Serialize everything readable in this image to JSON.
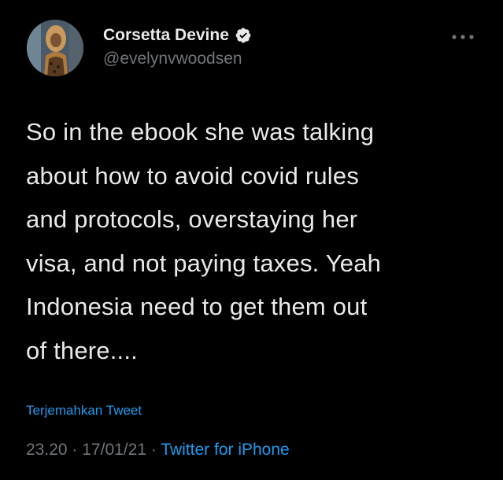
{
  "user": {
    "display_name": "Corsetta Devine",
    "handle": "@evelynvwoodsen",
    "verified": true
  },
  "tweet": {
    "text": "So in the ebook she was talking\nabout how to avoid covid rules\nand protocols, overstaying her\nvisa, and not paying taxes. Yeah\nIndonesia need to get them out\nof there....",
    "translate_label": "Terjemahkan Tweet",
    "time": "23.20",
    "date": "17/01/21",
    "separator": "·",
    "source": "Twitter for iPhone"
  },
  "icons": {
    "verified": "verified-badge-icon",
    "more": "more-options-icon"
  },
  "colors": {
    "background": "#000000",
    "text": "#e7e9ea",
    "secondary": "#71767b",
    "accent": "#1d9bf0"
  }
}
